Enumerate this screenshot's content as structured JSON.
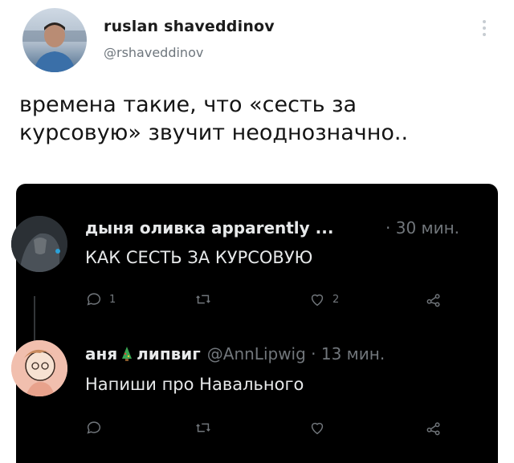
{
  "tweet": {
    "display_name": "ruslan shaveddinov",
    "handle": "@rshaveddinov",
    "text_lines": [
      "времена такие, что «сесть за",
      "курсовую» звучит неоднозначно.."
    ]
  },
  "replies": [
    {
      "display_name": "дыня оливка apparently ...",
      "meta": "· 30 мин.",
      "text": "КАК СЕСТЬ ЗА КУРСОВУЮ",
      "reply_count": "1",
      "like_count": "2"
    },
    {
      "display_name_a": "аня",
      "emoji_icon": "christmas-tree-icon",
      "display_name_b": "липвиг",
      "handle_meta": "@AnnLipwig · 13 мин.",
      "text": "Напиши про Навального"
    }
  ],
  "colors": {
    "dark_bg": "#000000",
    "primary_text_dark": "#e7e9ea",
    "secondary_text_dark": "#71767b",
    "handle_light": "#6e767d"
  }
}
